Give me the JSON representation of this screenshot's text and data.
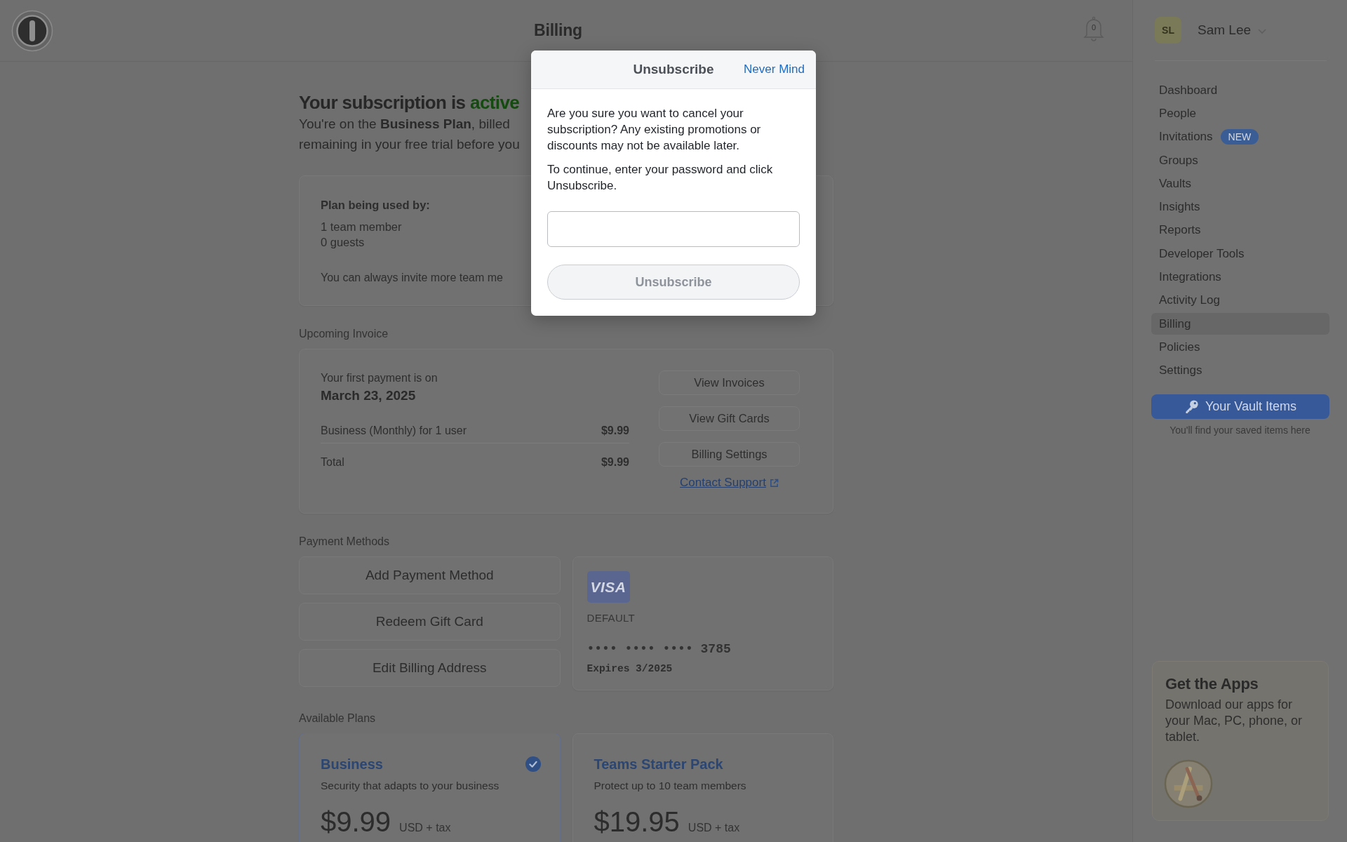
{
  "header": {
    "title": "Billing",
    "notification_count": "0"
  },
  "subscription": {
    "heading": "Your subscription is",
    "status": "active",
    "summary_lines": [
      "You're on the **Business Plan**, billed",
      "remaining in your free trial before you"
    ],
    "usage": {
      "title": "Plan being used by:",
      "lines": [
        "1 team member",
        "0 guests"
      ],
      "note": "You can always invite more team me"
    }
  },
  "upcoming_invoice": {
    "label": "Upcoming Invoice",
    "first_payment_label": "Your first payment is on",
    "first_payment_date": "March 23, 2025",
    "line_items": [
      {
        "kind": "item",
        "description": "Business (Monthly) for 1 user",
        "amount": "$9.99"
      },
      {
        "kind": "total",
        "description": "Total",
        "amount": "$9.99"
      }
    ],
    "actions": [
      "View Invoices",
      "View Gift Cards",
      "Billing Settings"
    ],
    "support_link": "Contact Support"
  },
  "payment_methods": {
    "label": "Payment Methods",
    "actions": [
      "Add Payment Method",
      "Redeem Gift Card",
      "Edit Billing Address"
    ],
    "card": {
      "brand": "VISA",
      "default_label": "DEFAULT",
      "number": "•••• •••• •••• 3785",
      "expiry": "Expires 3/2025"
    }
  },
  "available_plans": {
    "label": "Available Plans",
    "plans": [
      {
        "name": "Business",
        "description": "Security that adapts to your business",
        "price": "$9.99",
        "price_note": "USD + tax",
        "selected": true
      },
      {
        "name": "Teams Starter Pack",
        "description": "Protect up to 10 team members",
        "price": "$19.95",
        "price_note": "USD + tax",
        "selected": false
      }
    ]
  },
  "sidebar": {
    "account": {
      "initials": "SL",
      "name": "Sam Lee"
    },
    "items": [
      {
        "label": "Dashboard",
        "selected": false
      },
      {
        "label": "People",
        "selected": false
      },
      {
        "label": "Invitations",
        "selected": false,
        "badge": "NEW"
      },
      {
        "label": "Groups",
        "selected": false
      },
      {
        "label": "Vaults",
        "selected": false
      },
      {
        "label": "Insights",
        "selected": false
      },
      {
        "label": "Reports",
        "selected": false
      },
      {
        "label": "Developer Tools",
        "selected": false
      },
      {
        "label": "Integrations",
        "selected": false
      },
      {
        "label": "Activity Log",
        "selected": false
      },
      {
        "label": "Billing",
        "selected": true
      },
      {
        "label": "Policies",
        "selected": false
      },
      {
        "label": "Settings",
        "selected": false
      }
    ],
    "vault_button": "Your Vault Items",
    "vault_hint": "You'll find your saved items here",
    "apps_promo": {
      "title": "Get the Apps",
      "text": "Download our apps for your Mac, PC, phone, or tablet."
    }
  },
  "dialog": {
    "title": "Unsubscribe",
    "dismiss_link": "Never Mind",
    "paragraphs": [
      "Are you sure you want to cancel your subscription? Any existing promotions or discounts may not be available later.",
      "To continue, enter your password and click Unsubscribe."
    ],
    "submit": {
      "label": "Unsubscribe",
      "disabled": true
    }
  }
}
